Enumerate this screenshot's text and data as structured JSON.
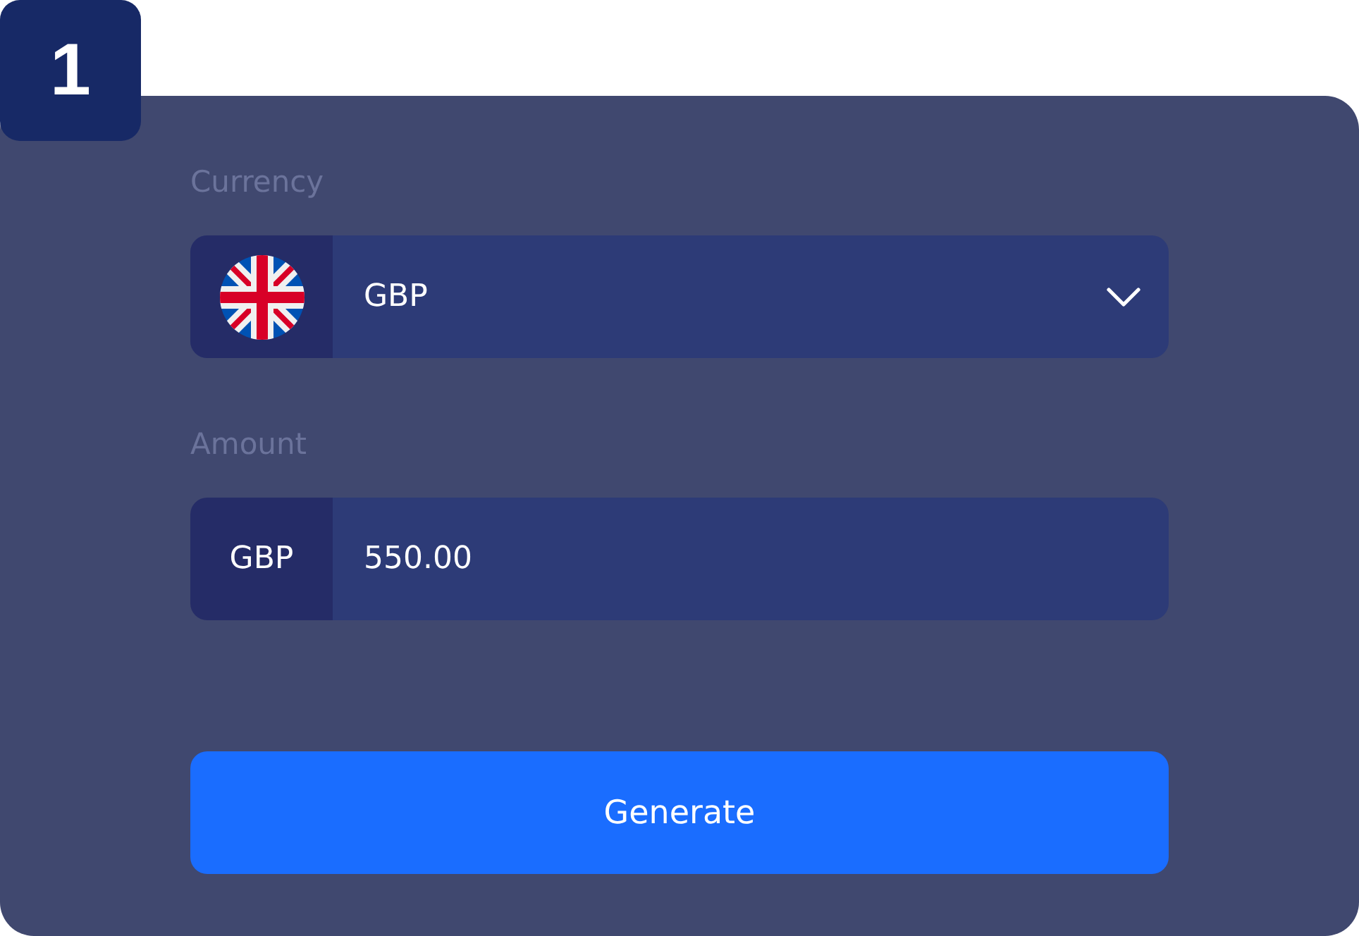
{
  "badge": {
    "number": "1"
  },
  "form": {
    "currency": {
      "label": "Currency",
      "value": "GBP"
    },
    "amount": {
      "label": "Amount",
      "currency": "GBP",
      "value": "550.00"
    },
    "button": {
      "label": "Generate"
    }
  }
}
